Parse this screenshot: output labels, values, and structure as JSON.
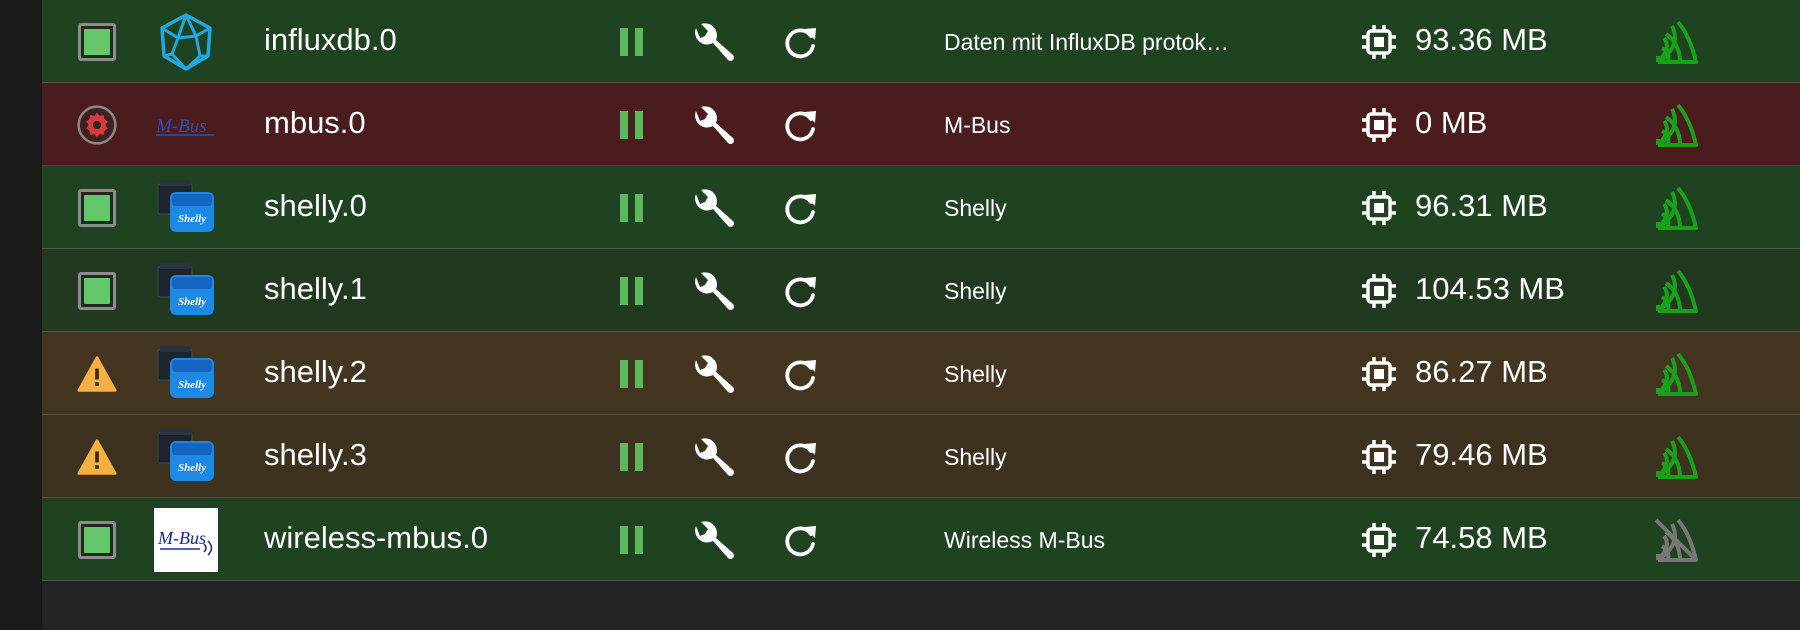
{
  "instances": [
    {
      "name": "influxdb.0",
      "description": "Daten mit InfluxDB protok…",
      "memory": "93.36 MB",
      "status": "running",
      "logo": "influxdb-logo",
      "logo_text": "",
      "connected": true
    },
    {
      "name": "mbus.0",
      "description": "M-Bus",
      "memory": "0 MB",
      "status": "error",
      "logo": "mbus-logo",
      "logo_text": "M-Bus",
      "connected": true
    },
    {
      "name": "shelly.0",
      "description": "Shelly",
      "memory": "96.31 MB",
      "status": "running",
      "logo": "shelly-logo",
      "logo_text": "Shelly",
      "connected": true
    },
    {
      "name": "shelly.1",
      "description": "Shelly",
      "memory": "104.53 MB",
      "status": "running",
      "logo": "shelly-logo",
      "logo_text": "Shelly",
      "connected": true
    },
    {
      "name": "shelly.2",
      "description": "Shelly",
      "memory": "86.27 MB",
      "status": "warning",
      "logo": "shelly-logo",
      "logo_text": "Shelly",
      "connected": true
    },
    {
      "name": "shelly.3",
      "description": "Shelly",
      "memory": "79.46 MB",
      "status": "warning",
      "logo": "shelly-logo",
      "logo_text": "Shelly",
      "connected": true
    },
    {
      "name": "wireless-mbus.0",
      "description": "Wireless M-Bus",
      "memory": "74.58 MB",
      "status": "running",
      "logo": "wireless-mbus-logo",
      "logo_text": "M-Bus",
      "connected": false
    }
  ],
  "icons": {
    "pause": "pause-icon",
    "settings": "wrench-icon",
    "restart": "restart-icon",
    "memory": "cpu-chip-icon",
    "connected": "signal-connected-icon",
    "disconnected": "signal-disconnected-icon"
  },
  "colors": {
    "running_row": "#1f4220",
    "error_row": "#4a1c1e",
    "warning_row": "#443520",
    "pause_green": "#5cb85c",
    "signal_green": "#1aa11a",
    "signal_off": "#777777",
    "warning_icon": "#f5b041",
    "error_icon": "#d63a3a"
  }
}
